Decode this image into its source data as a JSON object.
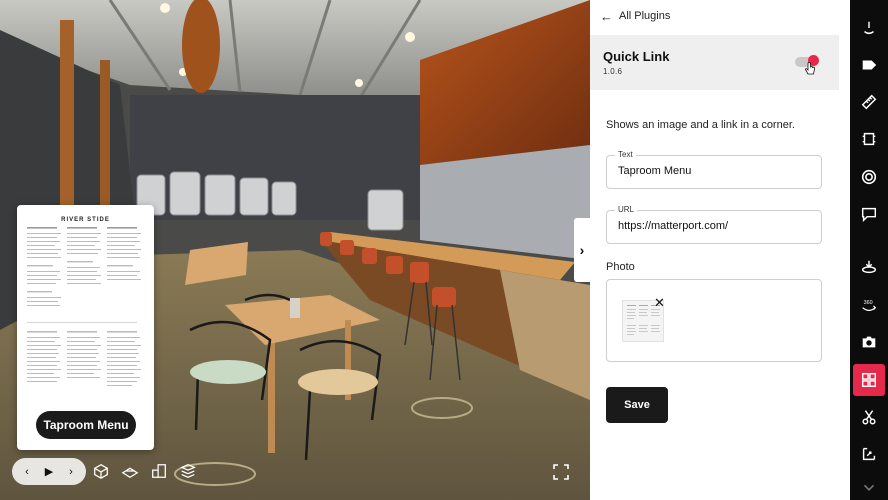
{
  "panel": {
    "back_label": "All Plugins",
    "plugin_name": "Quick Link",
    "plugin_version": "1.0.6",
    "description": "Shows an image and a link in a corner.",
    "text_field": {
      "label": "Text",
      "value": "Taproom Menu"
    },
    "url_field": {
      "label": "URL",
      "value": "https://matterport.com/"
    },
    "photo_label": "Photo",
    "save_label": "Save",
    "toggle_on": true
  },
  "viewer": {
    "menu_card_title": "RIVER STIDE",
    "link_pill_label": "Taproom Menu"
  },
  "toolbar": {
    "items": [
      "tag-icon",
      "ruler-icon",
      "crop-icon",
      "target-icon",
      "comment-icon",
      "floor-icon",
      "rotate-360-icon",
      "camera-icon",
      "plugins-icon",
      "scissors-icon",
      "fit-icon"
    ],
    "active": "plugins-icon"
  },
  "colors": {
    "accent": "#e4294a",
    "toolbar_bg": "#0c0c0c",
    "panel_bg": "#ffffff",
    "header_bg": "#efefef"
  }
}
